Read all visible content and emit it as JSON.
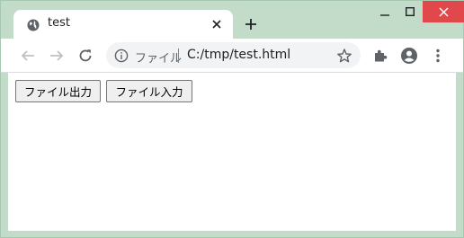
{
  "tab": {
    "title": "test",
    "favicon": "globe-icon"
  },
  "window_controls": {
    "close_color": "#e0484c"
  },
  "toolbar": {
    "scheme_label": "ファイル",
    "url": "C:/tmp/test.html"
  },
  "page": {
    "buttons": [
      {
        "label": "ファイル出力"
      },
      {
        "label": "ファイル入力"
      }
    ]
  }
}
